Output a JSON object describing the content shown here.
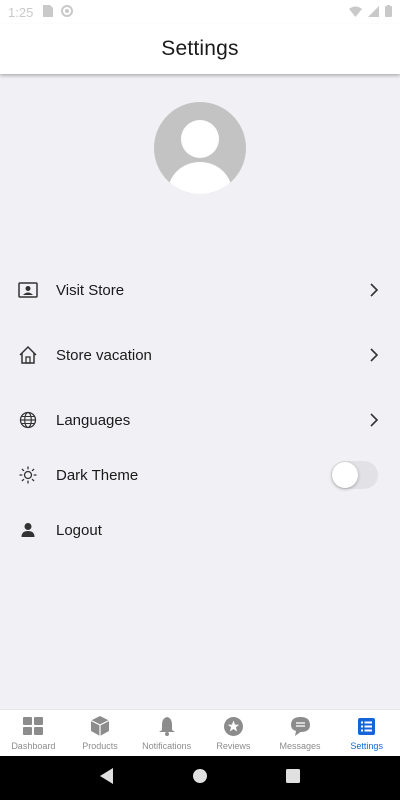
{
  "status_bar": {
    "time": "1:25"
  },
  "header": {
    "title": "Settings"
  },
  "menu": {
    "visit_store": "Visit Store",
    "store_vacation": "Store vacation",
    "languages": "Languages",
    "dark_theme": "Dark Theme",
    "logout": "Logout"
  },
  "dark_theme_enabled": false,
  "bottom_nav": {
    "tabs": [
      {
        "label": "Dashboard",
        "icon": "grid-icon"
      },
      {
        "label": "Products",
        "icon": "box-icon"
      },
      {
        "label": "Notifications",
        "icon": "bell-icon"
      },
      {
        "label": "Reviews",
        "icon": "star-icon"
      },
      {
        "label": "Messages",
        "icon": "chat-icon"
      },
      {
        "label": "Settings",
        "icon": "list-icon"
      }
    ],
    "active_tab": "Settings"
  },
  "colors": {
    "accent": "#1565d8",
    "background": "#f1f1f5",
    "inactive": "#8c8c8c"
  }
}
